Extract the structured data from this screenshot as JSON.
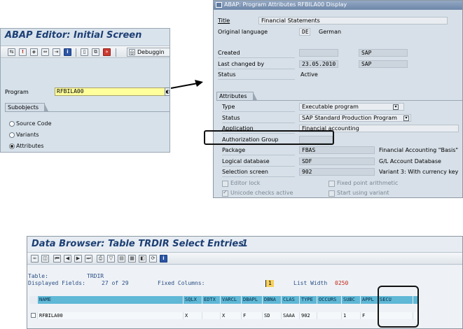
{
  "editor": {
    "title": "ABAP Editor: Initial Screen",
    "debug_label": "Debuggin",
    "program_label": "Program",
    "program_value": "RFBILA00",
    "subobjects_label": "Subobjects",
    "options": [
      "Source Code",
      "Variants",
      "Attributes"
    ],
    "selected_option": "Attributes"
  },
  "attributes": {
    "window_title": "ABAP: Program Attributes RFBILA00 Display",
    "title_label": "Title",
    "title_value": "Financial Statements",
    "original_language_label": "Original language",
    "language_code": "DE",
    "language_name": "German",
    "created_label": "Created",
    "created_user": "SAP",
    "last_changed_label": "Last changed by",
    "last_changed_date": "23.05.2010",
    "last_changed_user": "SAP",
    "status_label": "Status",
    "status_value": "Active",
    "section_label": "Attributes",
    "type_label": "Type",
    "type_value": "Executable program",
    "attr_status_label": "Status",
    "attr_status_value": "SAP Standard Production Program",
    "application_label": "Application",
    "application_value": "Financial accounting",
    "auth_group_label": "Authorization Group",
    "package_label": "Package",
    "package_value": "FBAS",
    "package_desc": "Financial Accounting \"Basis\"",
    "logical_db_label": "Logical database",
    "logical_db_value": "SDF",
    "logical_db_desc": "G/L Account Database",
    "selection_screen_label": "Selection screen",
    "selection_screen_value": "902",
    "selection_screen_desc": "Variant 3: With currency key",
    "editor_lock_label": "Editor lock",
    "fixed_point_label": "Fixed point arithmetic",
    "unicode_label": "Unicode checks active",
    "start_variant_label": "Start using variant"
  },
  "browser": {
    "title": "Data Browser: Table TRDIR Select Entries",
    "count": "1",
    "table_label": "Table:",
    "table_value": "TRDIR",
    "displayed_label": "Displayed Fields:",
    "displayed_value": "27 of  29",
    "fixed_label": "Fixed Columns:",
    "fixed_value": "1",
    "width_label": "List Width",
    "width_value": "0250",
    "columns": [
      "NAME",
      "SQLX",
      "EDTX",
      "VARCL",
      "DBAPL",
      "DBNA",
      "CLAS",
      "TYPE",
      "OCCURS",
      "SUBC",
      "APPL",
      "SECU"
    ],
    "row": [
      "RFBILA00",
      "X",
      "",
      "X",
      "F",
      "SD",
      "SAAA",
      "902",
      "",
      "1",
      "F",
      ""
    ]
  }
}
